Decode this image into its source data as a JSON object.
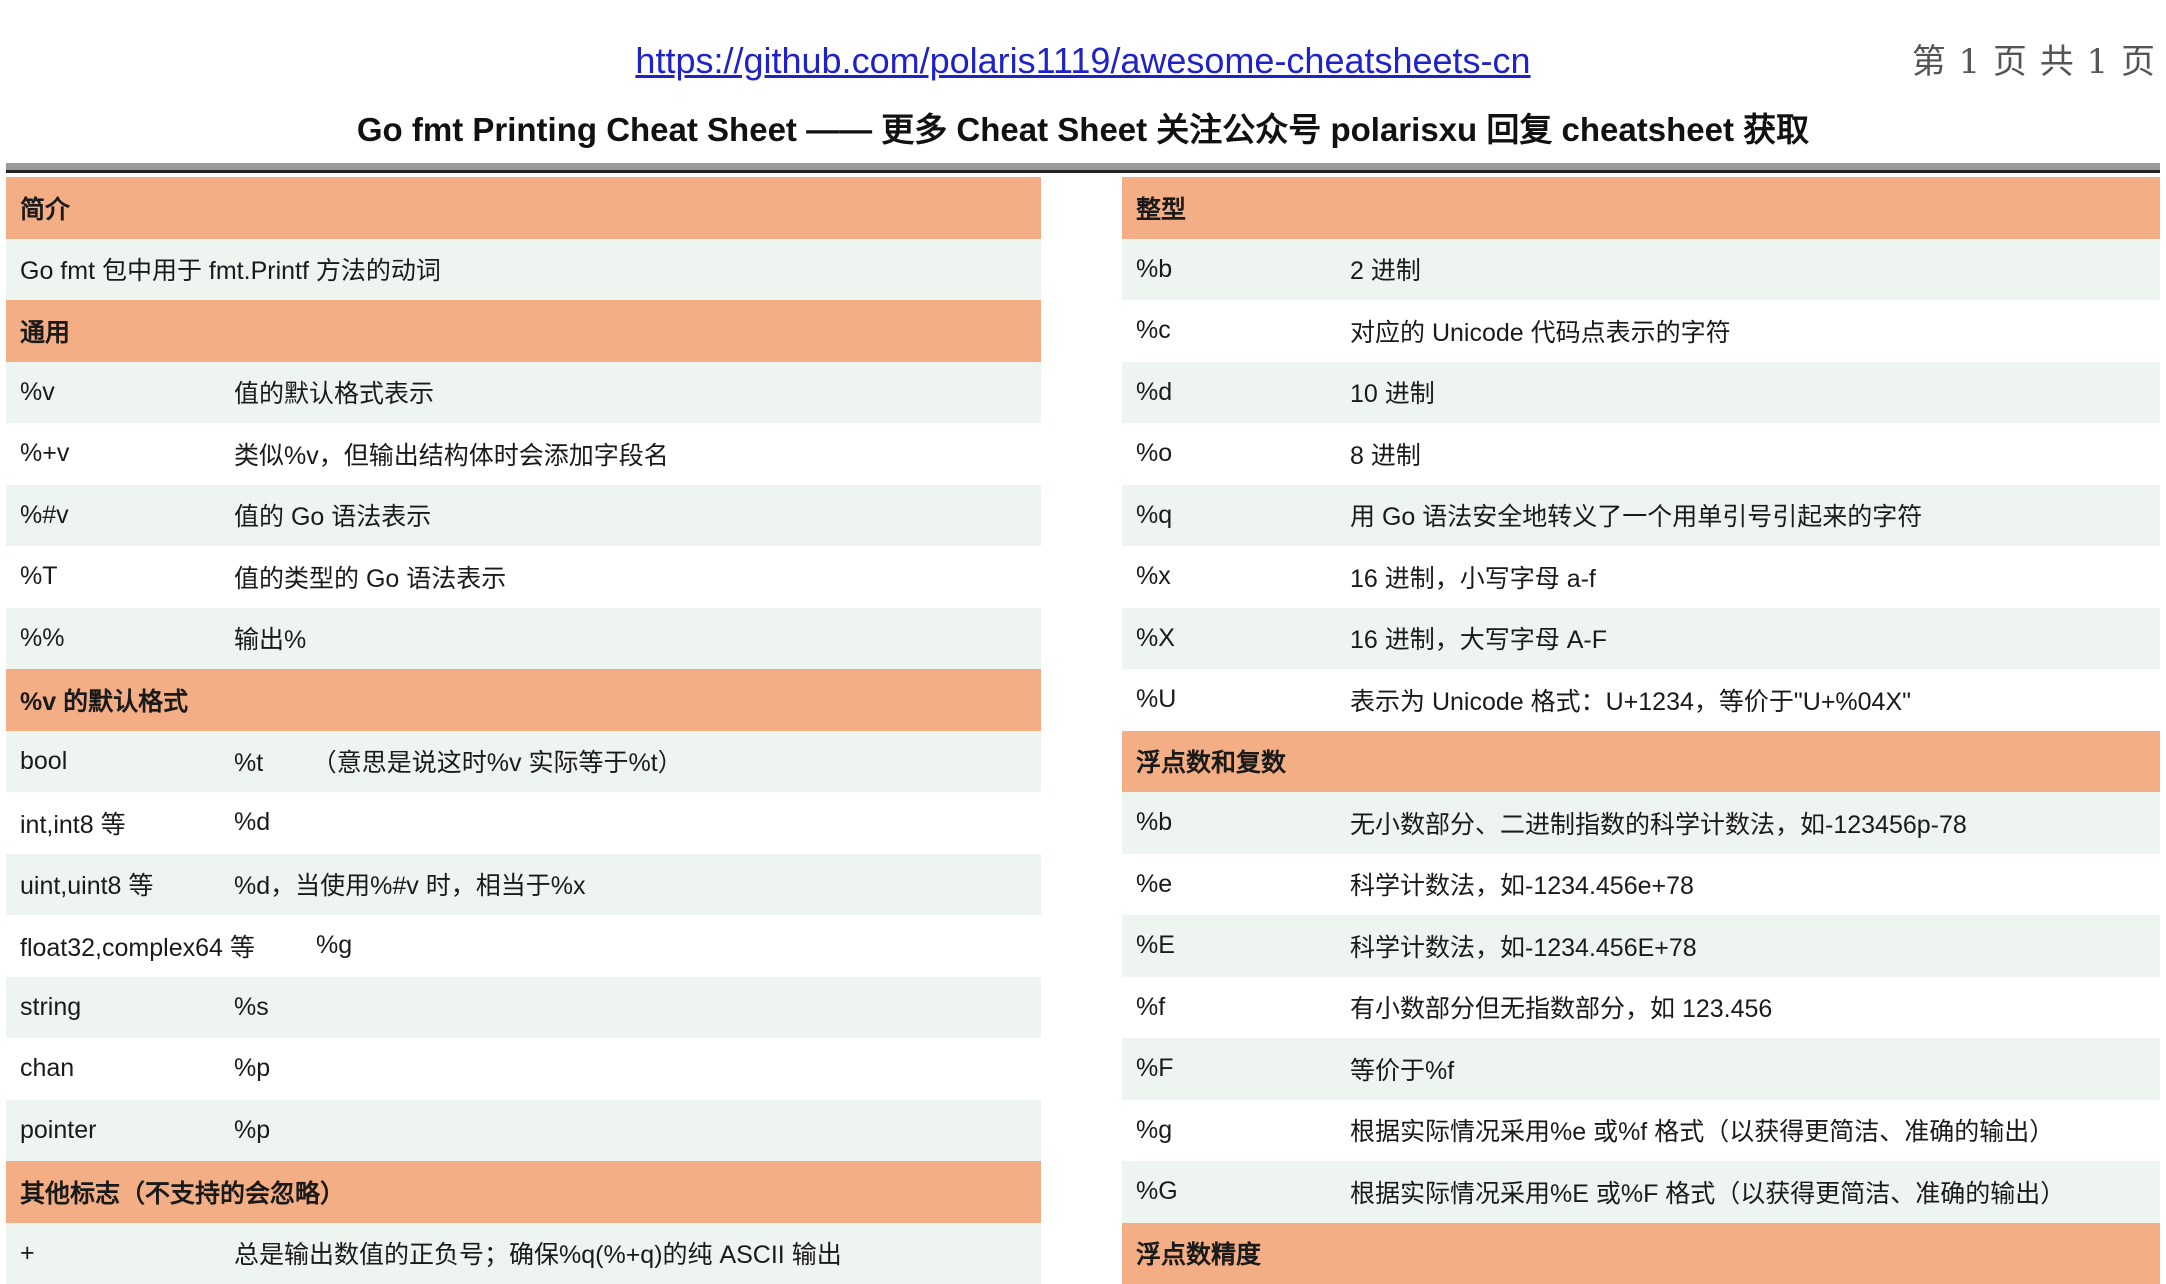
{
  "header": {
    "url": "https://github.com/polaris1119/awesome-cheatsheets-cn",
    "page_indicator": "第 1 页 共 1 页",
    "title": "Go fmt Printing Cheat Sheet —— 更多 Cheat Sheet 关注公众号 polarisxu 回复 cheatsheet 获取"
  },
  "colors": {
    "section_header": "#f4ae85",
    "row_shade": "#eef5f1",
    "link": "#1f22c8"
  },
  "left": {
    "intro_header": "简介",
    "intro_text": "Go fmt 包中用于 fmt.Printf 方法的动词",
    "general_header": "通用",
    "general": [
      {
        "key": "%v",
        "desc": "值的默认格式表示"
      },
      {
        "key": "%+v",
        "desc": "类似%v，但输出结构体时会添加字段名"
      },
      {
        "key": "%#v",
        "desc": "值的 Go 语法表示"
      },
      {
        "key": "%T",
        "desc": "值的类型的 Go 语法表示"
      },
      {
        "key": "%%",
        "desc": "输出%"
      }
    ],
    "default_header": "%v 的默认格式",
    "defaults": [
      {
        "key": "bool",
        "desc": "%t       （意思是说这时%v 实际等于%t）"
      },
      {
        "key": "int,int8 等",
        "desc": "%d"
      },
      {
        "key": "uint,uint8 等",
        "desc": "%d，当使用%#v 时，相当于%x"
      },
      {
        "key": "float32,complex64 等",
        "desc": "%g"
      },
      {
        "key": "string",
        "desc": "%s"
      },
      {
        "key": "chan",
        "desc": "%p"
      },
      {
        "key": "pointer",
        "desc": "%p"
      }
    ],
    "other_header": "其他标志（不支持的会忽略）",
    "other": [
      {
        "key": "+",
        "desc": "总是输出数值的正负号；确保%q(%+q)的纯 ASCII 输出"
      }
    ]
  },
  "right": {
    "int_header": "整型",
    "ints": [
      {
        "key": "%b",
        "desc": "2 进制"
      },
      {
        "key": "%c",
        "desc": "对应的 Unicode 代码点表示的字符"
      },
      {
        "key": "%d",
        "desc": "10 进制"
      },
      {
        "key": "%o",
        "desc": "8 进制"
      },
      {
        "key": "%q",
        "desc": "用 Go 语法安全地转义了一个用单引号引起来的字符"
      },
      {
        "key": "%x",
        "desc": "16 进制，小写字母  a-f"
      },
      {
        "key": "%X",
        "desc": "16 进制，大写字母 A-F"
      },
      {
        "key": "%U",
        "desc": "表示为 Unicode 格式：U+1234，等价于\"U+%04X\""
      }
    ],
    "float_header": "浮点数和复数",
    "floats": [
      {
        "key": "%b",
        "desc": "无小数部分、二进制指数的科学计数法，如-123456p-78"
      },
      {
        "key": "%e",
        "desc": "科学计数法，如-1234.456e+78"
      },
      {
        "key": "%E",
        "desc": "科学计数法，如-1234.456E+78"
      },
      {
        "key": "%f",
        "desc": "有小数部分但无指数部分，如 123.456"
      },
      {
        "key": "%F",
        "desc": "等价于%f"
      },
      {
        "key": "%g",
        "desc": "根据实际情况采用%e 或%f 格式（以获得更简洁、准确的输出）"
      },
      {
        "key": "%G",
        "desc": "根据实际情况采用%E 或%F 格式（以获得更简洁、准确的输出）"
      }
    ],
    "precision_header": "浮点数精度"
  }
}
